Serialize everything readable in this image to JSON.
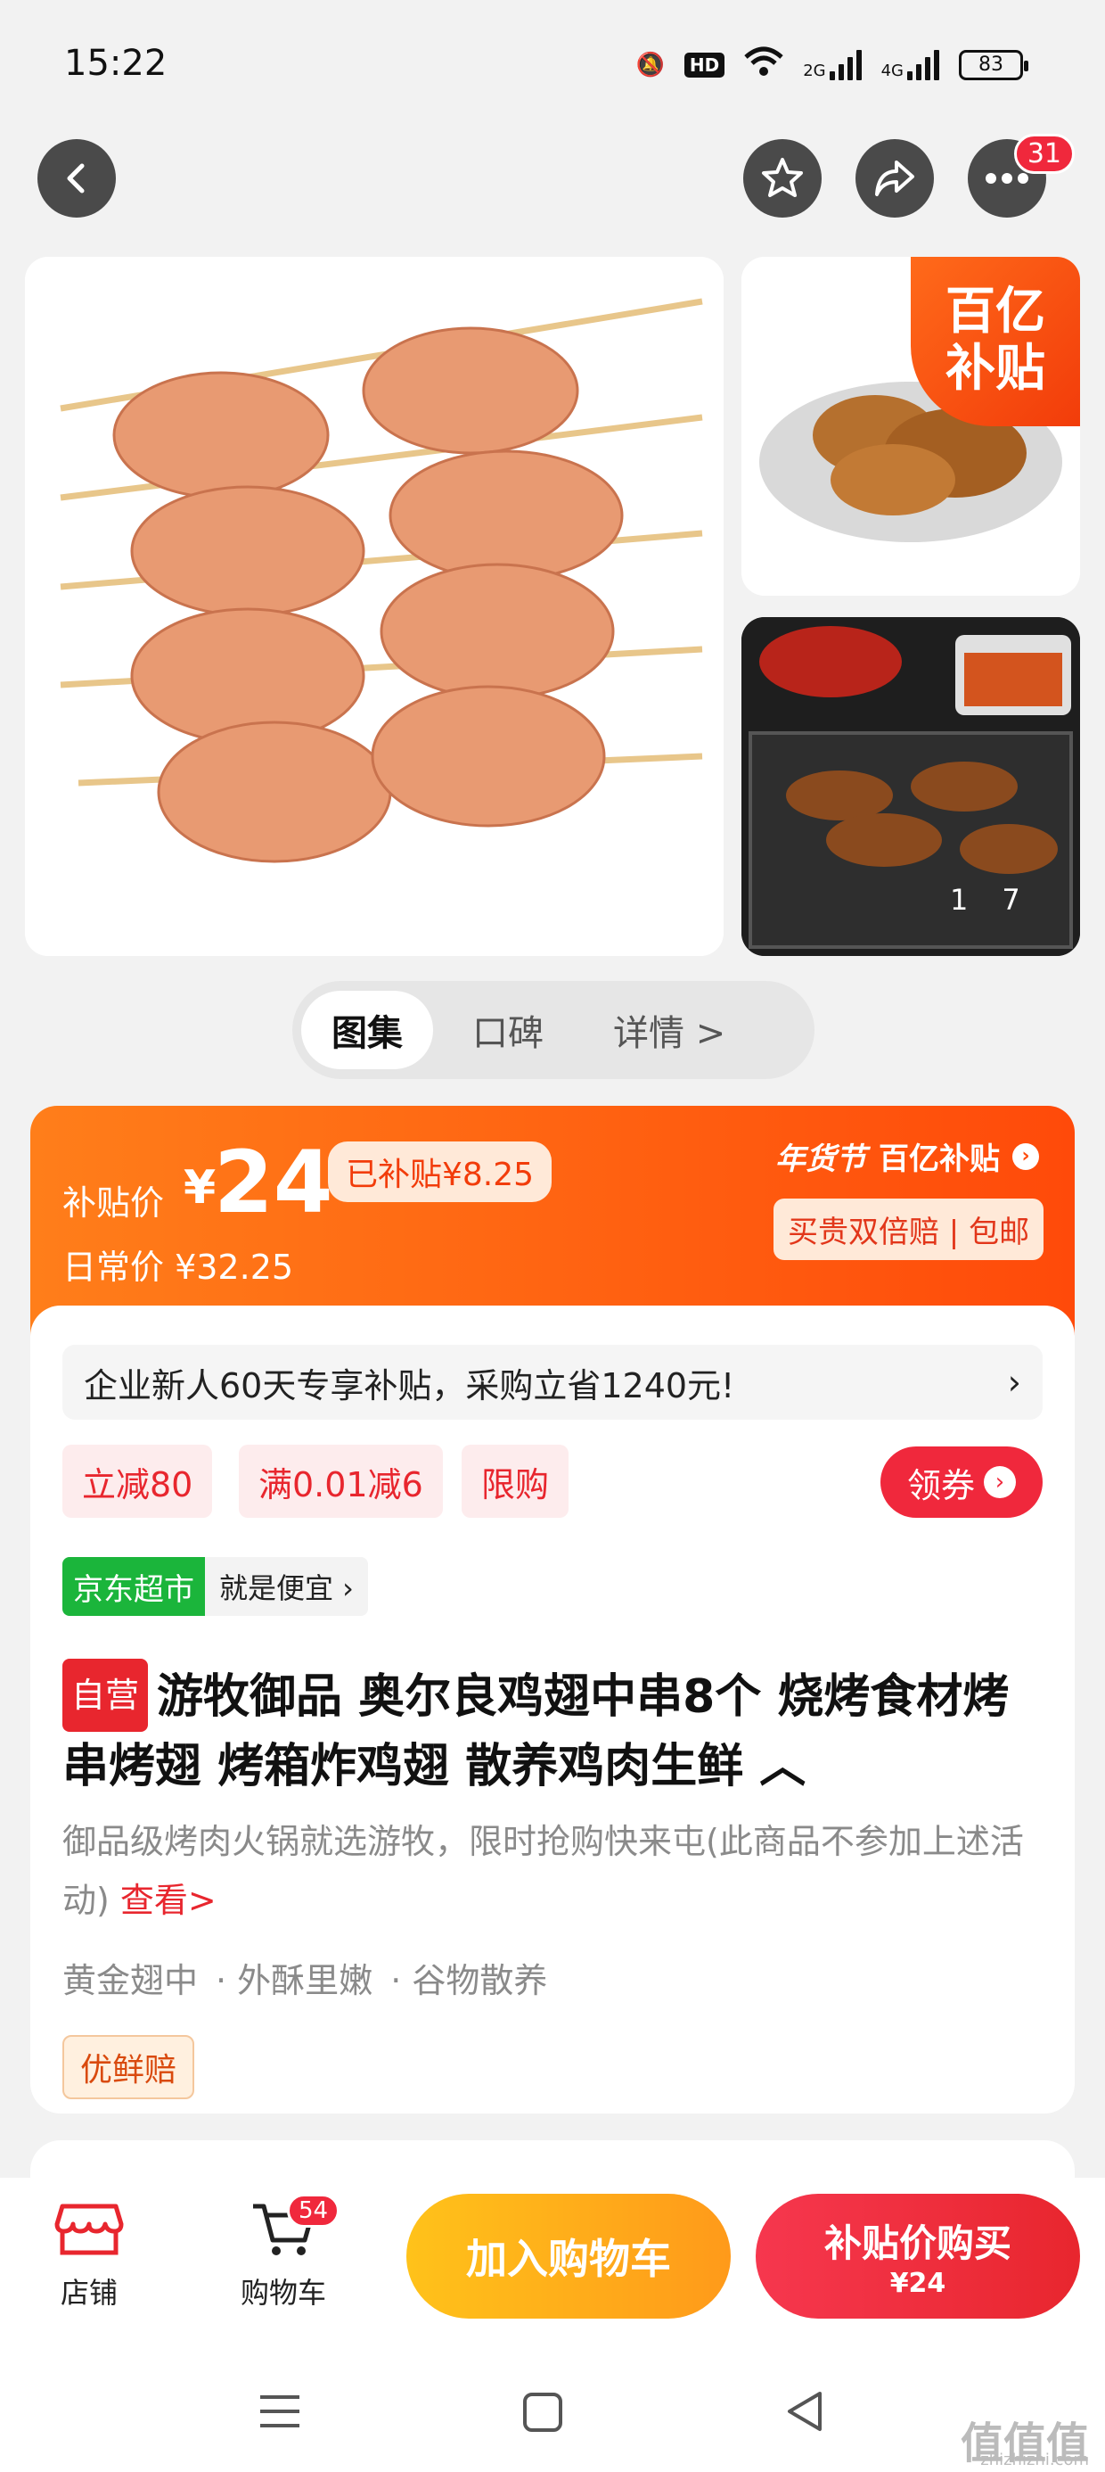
{
  "status_bar": {
    "time": "15:22",
    "hd_label": "HD",
    "net1": "2G",
    "net2": "4G",
    "battery": "83"
  },
  "nav": {
    "back_icon": "chevron-left-icon",
    "favorite_icon": "star-icon",
    "share_icon": "share-icon",
    "more_icon": "more-icon",
    "message_badge": "31"
  },
  "gallery": {
    "corner_badge_line1": "百亿",
    "corner_badge_line2": "补贴",
    "counter_current": "1",
    "counter_total": "7"
  },
  "tabs": [
    {
      "label": "图集"
    },
    {
      "label": "口碑"
    },
    {
      "label": "详情 >"
    }
  ],
  "price": {
    "subsidy_label": "补贴价",
    "currency": "¥",
    "subsidy_price": "24",
    "subsidized_amount": "已补贴¥8.25",
    "daily_price": "日常价 ¥32.25",
    "festival_label": "年货节",
    "program_label": "百亿补贴",
    "guarantee": "买贵双倍赔 | 包邮"
  },
  "promo": {
    "text": "企业新人60天专享补贴，采购立省1240元!",
    "arrow": "›"
  },
  "coupons": [
    "立减80",
    "满0.01减6",
    "限购"
  ],
  "get_coupon_label": "领券",
  "store_tag": {
    "name": "京东超市",
    "slogan": "就是便宜 ›"
  },
  "product": {
    "self_tag": "自营",
    "title": "游牧御品 奥尔良鸡翅中串8个 烧烤食材烤串烤翅 烤箱炸鸡翅 散养鸡肉生鲜 ︿",
    "description": "御品级烤肉火锅就选游牧，限时抢购快来屯(此商品不参加上述活动)",
    "description_link": "查看>",
    "features": [
      "黄金翅中",
      "· 外酥里嫩",
      "· 谷物散养"
    ],
    "service_tag": "优鲜赔"
  },
  "bottom_bar": {
    "store_label": "店铺",
    "cart_label": "购物车",
    "cart_count": "54",
    "add_to_cart": "加入购物车",
    "buy_line1": "补贴价购买",
    "buy_line2": "¥24"
  },
  "watermark": {
    "main": "值值值",
    "sub": "zhizhizhi.com"
  }
}
